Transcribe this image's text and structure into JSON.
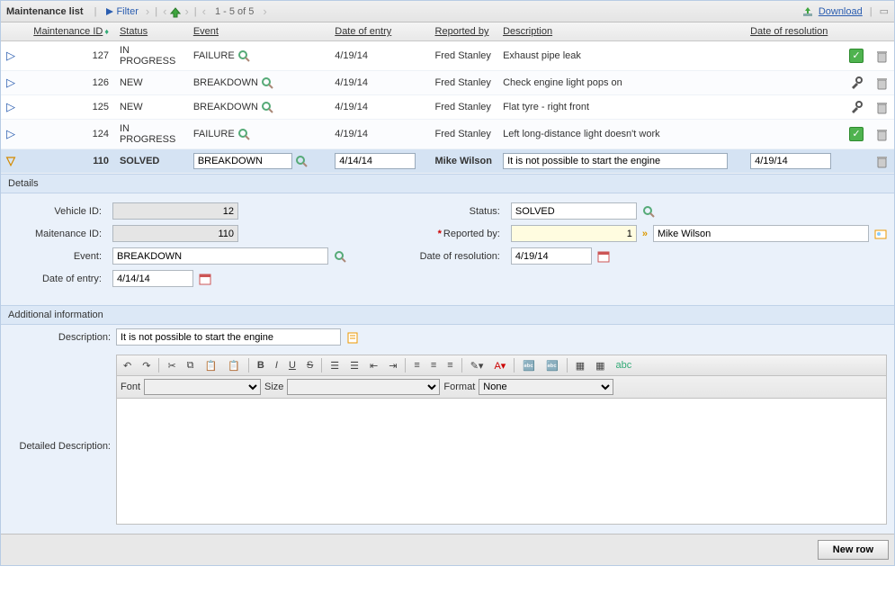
{
  "toolbar": {
    "title": "Maintenance list",
    "filter_label": "Filter",
    "pager": "1 - 5 of 5",
    "download_label": "Download"
  },
  "columns": {
    "maintenance_id": "Maintenance ID",
    "status": "Status",
    "event": "Event",
    "date_of_entry": "Date of entry",
    "reported_by": "Reported by",
    "description": "Description",
    "date_of_resolution": "Date of resolution"
  },
  "rows": [
    {
      "id": "127",
      "status": "IN PROGRESS",
      "event": "FAILURE",
      "date_entry": "4/19/14",
      "reporter": "Fred Stanley",
      "description": "Exhaust pipe leak",
      "date_res": "",
      "action": "check"
    },
    {
      "id": "126",
      "status": "NEW",
      "event": "BREAKDOWN",
      "date_entry": "4/19/14",
      "reporter": "Fred Stanley",
      "description": "Check engine light pops on",
      "date_res": "",
      "action": "tools"
    },
    {
      "id": "125",
      "status": "NEW",
      "event": "BREAKDOWN",
      "date_entry": "4/19/14",
      "reporter": "Fred Stanley",
      "description": "Flat tyre - right front",
      "date_res": "",
      "action": "tools"
    },
    {
      "id": "124",
      "status": "IN PROGRESS",
      "event": "FAILURE",
      "date_entry": "4/19/14",
      "reporter": "Fred Stanley",
      "description": "Left long-distance light doesn't work",
      "date_res": "",
      "action": "check"
    },
    {
      "id": "110",
      "status": "SOLVED",
      "event": "BREAKDOWN",
      "date_entry": "4/14/14",
      "reporter": "Mike Wilson",
      "description": "It is not possible to start the engine",
      "date_res": "4/19/14",
      "action": "none",
      "selected": true
    }
  ],
  "details": {
    "section_label": "Details",
    "vehicle_id_label": "Vehicle ID:",
    "vehicle_id": "12",
    "maintenance_id_label": "Maitenance ID:",
    "maintenance_id": "110",
    "event_label": "Event:",
    "event": "BREAKDOWN",
    "date_entry_label": "Date of entry:",
    "date_entry": "4/14/14",
    "status_label": "Status:",
    "status": "SOLVED",
    "reported_by_label": "Reported by:",
    "reported_by_id": "1",
    "reported_by_name": "Mike Wilson",
    "date_res_label": "Date of resolution:",
    "date_res": "4/19/14"
  },
  "additional": {
    "section_label": "Additional information",
    "description_label": "Description:",
    "description": "It is not possible to start the engine",
    "detailed_label": "Detailed Description:",
    "font_label": "Font",
    "size_label": "Size",
    "format_label": "Format",
    "format_value": "None"
  },
  "footer": {
    "new_row": "New row"
  }
}
